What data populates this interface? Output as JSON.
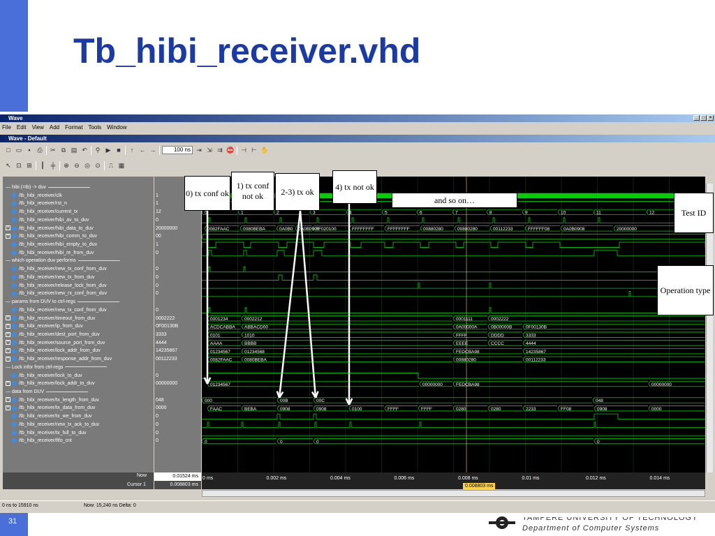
{
  "slide": {
    "title": "Tb_hibi_receiver.vhd",
    "number": "31",
    "university": "TAMPERE UNIVERSITY OF TECHNOLOGY",
    "department": "Department of Computer Systems"
  },
  "window": {
    "title": "Wave",
    "subtitle": "Wave - Default",
    "menu": [
      "File",
      "Edit",
      "View",
      "Add",
      "Format",
      "Tools",
      "Window"
    ],
    "zoom_value": "100 ns"
  },
  "signals": [
    {
      "kind": "divider",
      "name": "hibi (=tb) -> duv",
      "value": ""
    },
    {
      "kind": "sig",
      "name": "/tb_hibi_receiver/clk",
      "value": "1",
      "bus": false
    },
    {
      "kind": "sig",
      "name": "/tb_hibi_receiver/rst_n",
      "value": "1",
      "bus": false
    },
    {
      "kind": "sig",
      "name": "/tb_hibi_receiver/current_tx",
      "value": "12",
      "bus": false
    },
    {
      "kind": "sig",
      "name": "/tb_hibi_receiver/hibi_av_to_duv",
      "value": "0",
      "bus": false
    },
    {
      "kind": "sig",
      "name": "/tb_hibi_receiver/hibi_data_to_duv",
      "value": "20000000",
      "bus": true
    },
    {
      "kind": "sig",
      "name": "/tb_hibi_receiver/hibi_comm_to_duv",
      "value": "00",
      "bus": true
    },
    {
      "kind": "sig",
      "name": "/tb_hibi_receiver/hibi_empty_to_duv",
      "value": "1",
      "bus": false
    },
    {
      "kind": "sig",
      "name": "/tb_hibi_receiver/hibi_re_from_duv",
      "value": "0",
      "bus": false
    },
    {
      "kind": "divider",
      "name": "which operation duv performs",
      "value": ""
    },
    {
      "kind": "sig",
      "name": "/tb_hibi_receiver/new_tx_conf_from_duv",
      "value": "0",
      "bus": false
    },
    {
      "kind": "sig",
      "name": "/tb_hibi_receiver/new_tx_from_duv",
      "value": "0",
      "bus": false
    },
    {
      "kind": "sig",
      "name": "/tb_hibi_receiver/release_lock_from_duv",
      "value": "0",
      "bus": false
    },
    {
      "kind": "sig",
      "name": "/tb_hibi_receiver/new_rx_conf_from_duv",
      "value": "0",
      "bus": false
    },
    {
      "kind": "divider",
      "name": "params from DUV to ctrl-regs",
      "value": ""
    },
    {
      "kind": "sig",
      "name": "/tb_hibi_receiver/new_tx_conf_from_duv",
      "value": "0",
      "bus": false
    },
    {
      "kind": "sig",
      "name": "/tb_hibi_receiver/timeout_from_duv",
      "value": "0002222",
      "bus": true
    },
    {
      "kind": "sig",
      "name": "/tb_hibi_receiver/ip_from_duv",
      "value": "0F00130B",
      "bus": true
    },
    {
      "kind": "sig",
      "name": "/tb_hibi_receiver/dest_port_from_duv",
      "value": "3333",
      "bus": true
    },
    {
      "kind": "sig",
      "name": "/tb_hibi_receiver/source_port_from_duv",
      "value": "4444",
      "bus": true
    },
    {
      "kind": "sig",
      "name": "/tb_hibi_receiver/lock_addr_from_duv",
      "value": "14235867",
      "bus": true
    },
    {
      "kind": "sig",
      "name": "/tb_hibi_receiver/response_addr_from_duv",
      "value": "00112233",
      "bus": true
    },
    {
      "kind": "divider",
      "name": "Lock infor from ctrl-regs",
      "value": ""
    },
    {
      "kind": "sig",
      "name": "/tb_hibi_receiver/lock_to_duv",
      "value": "0",
      "bus": false
    },
    {
      "kind": "sig",
      "name": "/tb_hibi_receiver/lock_addr_to_duv",
      "value": "00000000",
      "bus": true
    },
    {
      "kind": "divider",
      "name": "data from DUV",
      "value": ""
    },
    {
      "kind": "sig",
      "name": "/tb_hibi_receiver/tx_length_from_duv",
      "value": "048",
      "bus": true
    },
    {
      "kind": "sig",
      "name": "/tb_hibi_receiver/tx_data_from_duv",
      "value": "0000",
      "bus": true
    },
    {
      "kind": "sig",
      "name": "/tb_hibi_receiver/tx_we_from_duv",
      "value": "0",
      "bus": false
    },
    {
      "kind": "sig",
      "name": "/tb_hibi_receiver/new_tx_ack_to_duv",
      "value": "0",
      "bus": false
    },
    {
      "kind": "sig",
      "name": "/tb_hibi_receiver/tx_full_to_duv",
      "value": "0",
      "bus": false
    },
    {
      "kind": "sig",
      "name": "/tb_hibi_receiver/fifo_cnt",
      "value": "0",
      "bus": false
    }
  ],
  "wave_labels": {
    "current_tx": [
      "0",
      "1",
      "2",
      "3",
      "4",
      "5",
      "6",
      "7",
      "8",
      "9",
      "10",
      "11",
      "12"
    ],
    "hibi_data": [
      "0082FAAC",
      "0080BEBA",
      "0A0B0",
      "0A0B0908",
      "FF020100",
      "FFFFFFFF",
      "FFFFFFFF",
      "00880280",
      "00880280",
      "00112233",
      "FFFFFF08",
      "0A0B0908",
      "20000000"
    ],
    "timeout": [
      "0001234",
      "0002212",
      "0001111",
      "0002222"
    ],
    "ip": [
      "ACDCABBA",
      "ABBACD00",
      "0A00000A",
      "0B00000B",
      "0F00130B"
    ],
    "dest_port": [
      "0101",
      "1010",
      "FFFF",
      "DDDD",
      "3333"
    ],
    "source_port": [
      "AAAA",
      "BBBB",
      "EEEE",
      "CCCC",
      "4444"
    ],
    "lock_addr": [
      "01234567",
      "01234568",
      "FEDCBA98",
      "14235867"
    ],
    "response_addr": [
      "0082FAAC",
      "0080BEBA",
      "00880280",
      "00112233"
    ],
    "lock_addr_to": [
      "01234567",
      "00000000",
      "FEDCBA98",
      "00000000"
    ],
    "tx_length": [
      "000",
      "00B",
      "00C",
      "048"
    ],
    "tx_data": [
      "FAAC",
      "BEBA",
      "0908",
      "0908",
      "0100",
      "FFFF",
      "FFFF",
      "0280",
      "0280",
      "2233",
      "FF08",
      "0908",
      "0000"
    ],
    "fifo_cnt": [
      "0",
      "0",
      "0",
      "0"
    ]
  },
  "timeline": {
    "now_label": "Now",
    "now_value": "0.01524 ms",
    "cursor_label": "Cursor 1",
    "cursor_value": "0.008803 ms",
    "cursor_tag": "0.008803 ms",
    "ticks": [
      "0 ms",
      "0.002 ms",
      "0.004 ms",
      "0.006 ms",
      "0.008 ms",
      "0.01 ms",
      "0.012 ms",
      "0.014 ms"
    ]
  },
  "status": {
    "range": "0 ns to 15910 ns",
    "now": "Now: 15,240 ns  Delta: 0"
  },
  "annotations": {
    "a0": "0) tx conf ok",
    "a1": "1) tx conf not ok",
    "a23": "2-3) tx ok",
    "a4": "4) tx not ok",
    "and_so_on": "and so on…",
    "test_id": "Test ID",
    "op_type": "Operation type"
  },
  "colors": {
    "title": "#1a3aa8",
    "wave": "#00d000",
    "wave_bg": "#000000",
    "name_bg": "#7a7a7a"
  }
}
